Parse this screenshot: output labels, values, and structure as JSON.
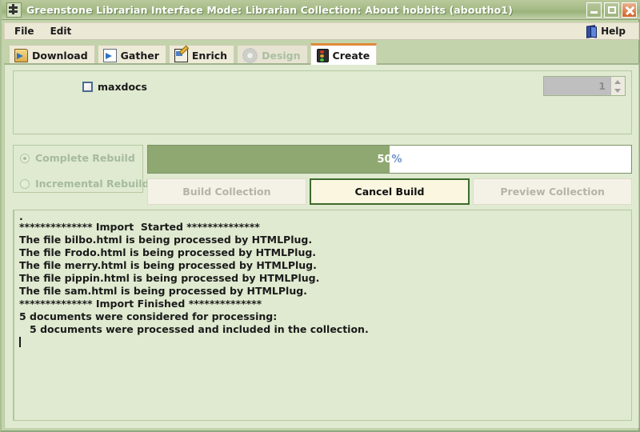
{
  "window": {
    "title": "Greenstone Librarian Interface  Mode: Librarian  Collection: About hobbits (aboutho1)",
    "icon": "greenstone-logo-icon",
    "buttons": {
      "minimize": "minimize-icon",
      "maximize": "maximize-icon",
      "close": "close-icon"
    },
    "colors": {
      "titlebar": "#a4ba84",
      "content_bg": "#dfead0",
      "accent_orange": "#e08a3c",
      "progress_fill": "#8fa871",
      "primary_button_border": "#3e6b2c"
    }
  },
  "menubar": {
    "items": [
      {
        "label": "File"
      },
      {
        "label": "Edit"
      }
    ],
    "help": {
      "label": "Help",
      "icon": "help-book-icon"
    }
  },
  "tabs": [
    {
      "label": "Download",
      "icon": "folder-download-icon",
      "state": "enabled"
    },
    {
      "label": "Gather",
      "icon": "page-arrow-icon",
      "state": "enabled"
    },
    {
      "label": "Enrich",
      "icon": "page-pencil-icon",
      "state": "enabled"
    },
    {
      "label": "Design",
      "icon": "gear-icon",
      "state": "disabled"
    },
    {
      "label": "Create",
      "icon": "traffic-light-icon",
      "state": "active"
    }
  ],
  "options": {
    "maxdocs": {
      "label": "maxdocs",
      "checked": false,
      "spinner_value": "1",
      "spinner_enabled": false,
      "spinner_up_icon": "chevron-up-icon",
      "spinner_down_icon": "chevron-down-icon"
    }
  },
  "build": {
    "rebuild_options": [
      {
        "label": "Complete Rebuild",
        "selected": true,
        "enabled": false
      },
      {
        "label": "Incremental Rebuild",
        "selected": false,
        "enabled": false
      }
    ],
    "progress": {
      "percent": 50,
      "number_text": "50",
      "percent_symbol": "%"
    },
    "buttons": [
      {
        "label": "Build Collection",
        "enabled": false,
        "primary": false
      },
      {
        "label": "Cancel Build",
        "enabled": true,
        "primary": true
      },
      {
        "label": "Preview Collection",
        "enabled": false,
        "primary": false
      }
    ]
  },
  "log": {
    "lines": [
      ".",
      "************** Import  Started **************",
      "The file bilbo.html is being processed by HTMLPlug.",
      "The file Frodo.html is being processed by HTMLPlug.",
      "The file merry.html is being processed by HTMLPlug.",
      "The file pippin.html is being processed by HTMLPlug.",
      "The file sam.html is being processed by HTMLPlug.",
      "************** Import Finished **************",
      "5 documents were considered for processing:",
      "   5 documents were processed and included in the collection."
    ]
  }
}
